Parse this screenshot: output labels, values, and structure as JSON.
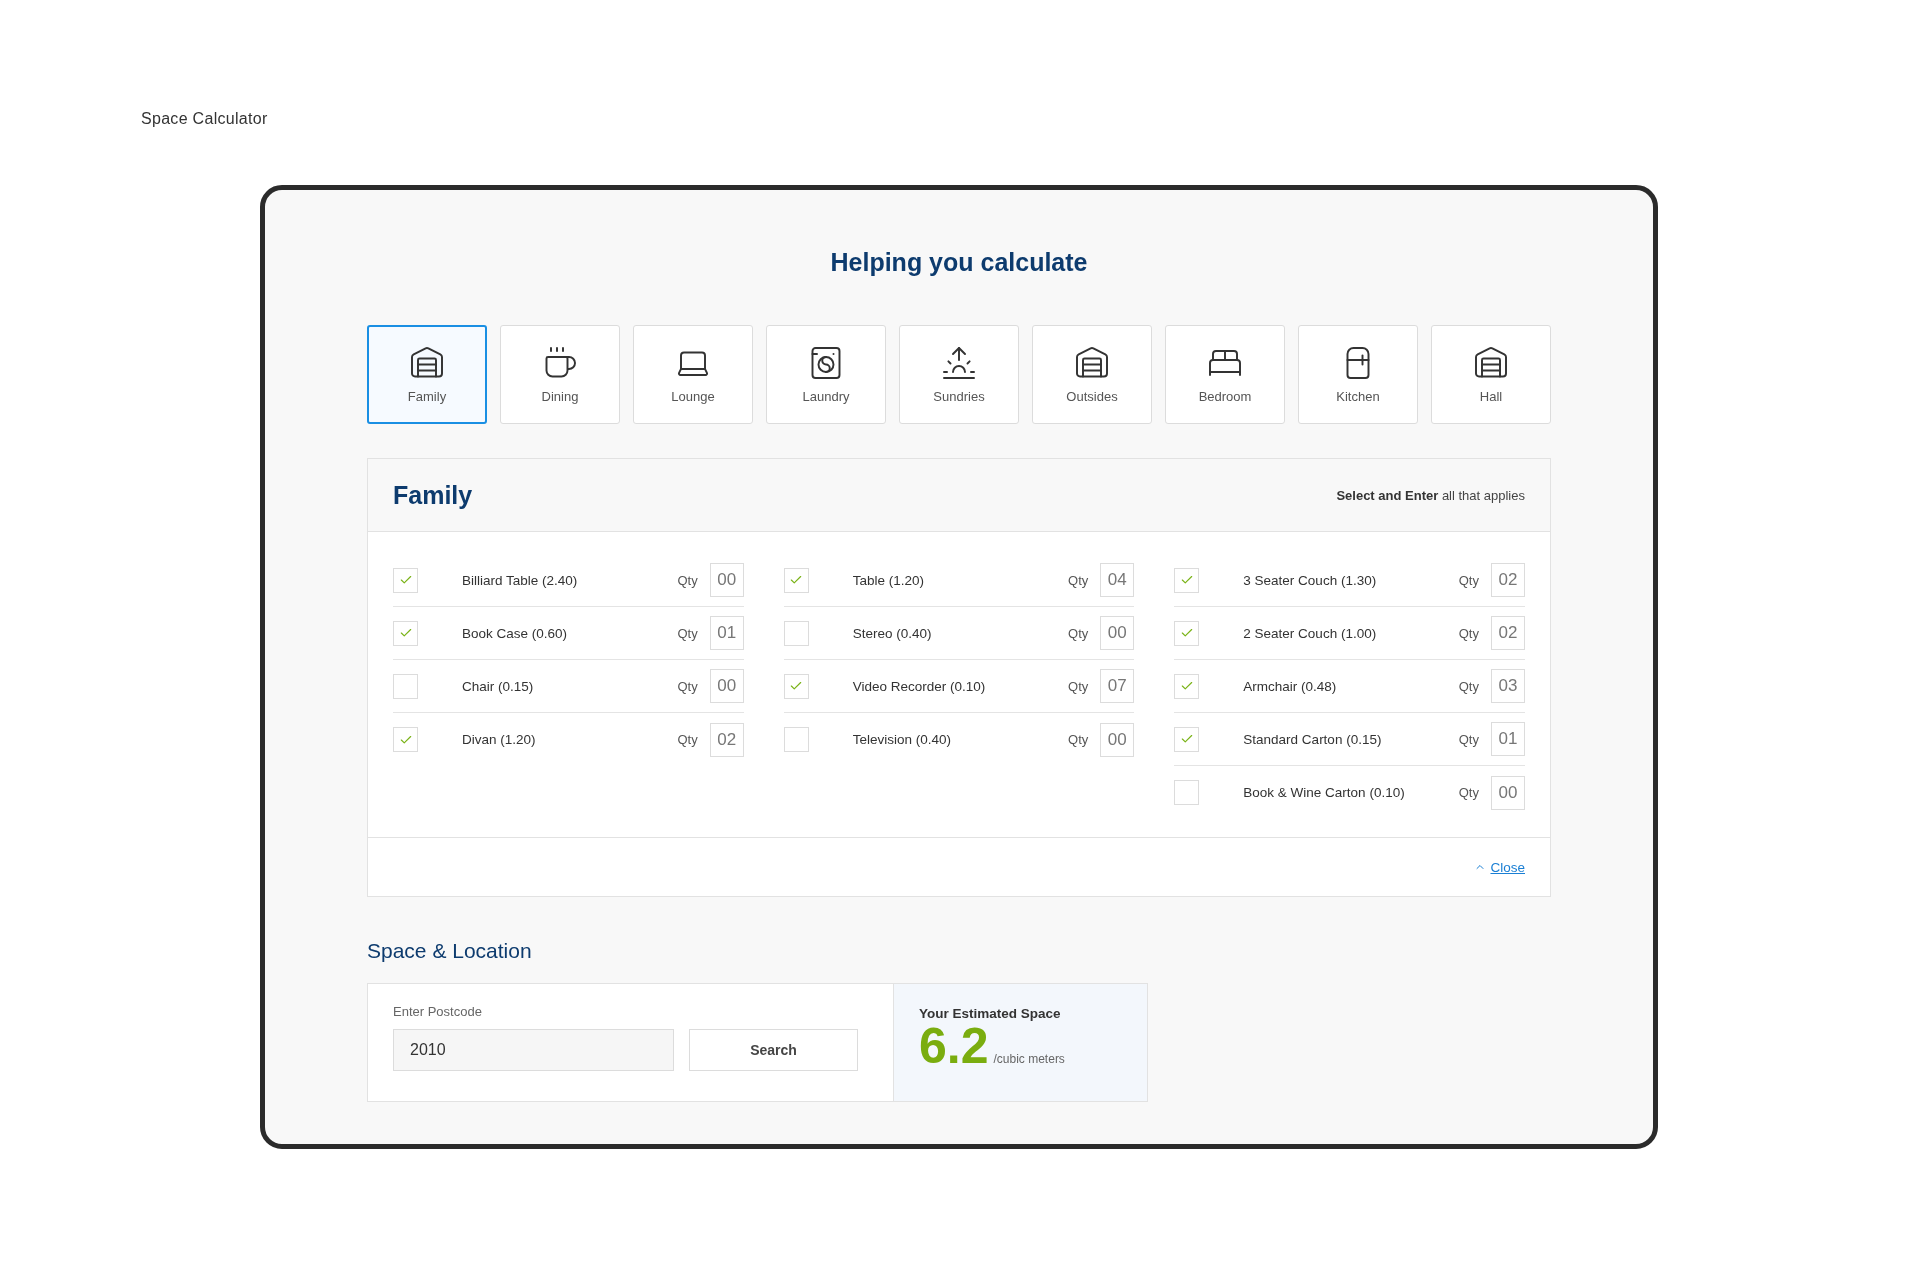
{
  "page_label": "Space Calculator",
  "title": "Helping you calculate",
  "tabs": [
    {
      "label": "Family",
      "selected": true
    },
    {
      "label": "Dining",
      "selected": false
    },
    {
      "label": "Lounge",
      "selected": false
    },
    {
      "label": "Laundry",
      "selected": false
    },
    {
      "label": "Sundries",
      "selected": false
    },
    {
      "label": "Outsides",
      "selected": false
    },
    {
      "label": "Bedroom",
      "selected": false
    },
    {
      "label": "Kitchen",
      "selected": false
    },
    {
      "label": "Hall",
      "selected": false
    }
  ],
  "panel": {
    "title": "Family",
    "hint": "**Select and Enter** all that applies",
    "close_label": "Close",
    "columns": [
      [
        {
          "label": "Billiard Table (2.40)",
          "checked": true,
          "qty_label": "Qty",
          "qty": "00"
        },
        {
          "label": "Book Case (0.60)",
          "checked": true,
          "qty_label": "Qty",
          "qty": "01"
        },
        {
          "label": "Chair (0.15)",
          "checked": false,
          "qty_label": "Qty",
          "qty": "00"
        },
        {
          "label": "Divan (1.20)",
          "checked": true,
          "qty_label": "Qty",
          "qty": "02"
        }
      ],
      [
        {
          "label": "Table (1.20)",
          "checked": true,
          "qty_label": "Qty",
          "qty": "04"
        },
        {
          "label": "Stereo (0.40)",
          "checked": false,
          "qty_label": "Qty",
          "qty": "00"
        },
        {
          "label": "Video Recorder (0.10)",
          "checked": true,
          "qty_label": "Qty",
          "qty": "07"
        },
        {
          "label": "Television (0.40)",
          "checked": false,
          "qty_label": "Qty",
          "qty": "00"
        }
      ],
      [
        {
          "label": "3 Seater Couch (1.30)",
          "checked": true,
          "qty_label": "Qty",
          "qty": "02"
        },
        {
          "label": "2 Seater Couch (1.00)",
          "checked": true,
          "qty_label": "Qty",
          "qty": "02"
        },
        {
          "label": "Armchair (0.48)",
          "checked": true,
          "qty_label": "Qty",
          "qty": "03"
        },
        {
          "label": "Standard Carton (0.15)",
          "checked": true,
          "qty_label": "Qty",
          "qty": "01"
        },
        {
          "label": "Book & Wine Carton (0.10)",
          "checked": false,
          "qty_label": "Qty",
          "qty": "00"
        }
      ]
    ]
  },
  "location": {
    "title": "Space & Location",
    "postcode_label": "Enter Postcode",
    "postcode": "2010",
    "search_button": "Search",
    "estimate_label": "Your Estimated Space",
    "estimate_value": "6.2",
    "estimate_unit": "/cubic meters"
  }
}
